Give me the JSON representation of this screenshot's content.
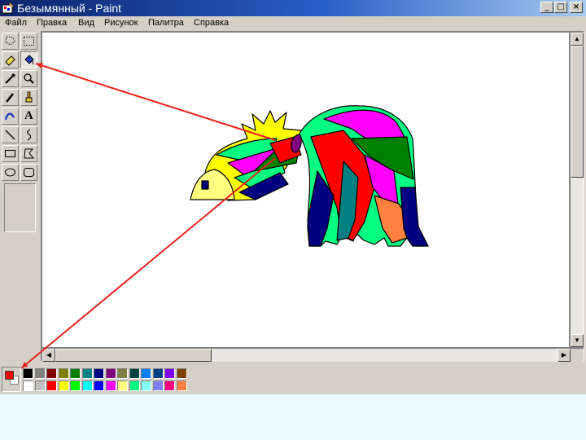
{
  "window": {
    "title": "Безымянный - Paint",
    "app_icon": "paint-app-icon",
    "controls": [
      {
        "name": "minimize-button",
        "glyph": "_"
      },
      {
        "name": "maximize-button",
        "glyph": "□"
      },
      {
        "name": "close-button",
        "glyph": "×"
      }
    ]
  },
  "menu": [
    {
      "label": "Файл"
    },
    {
      "label": "Правка"
    },
    {
      "label": "Вид"
    },
    {
      "label": "Рисунок"
    },
    {
      "label": "Палитра"
    },
    {
      "label": "Справка"
    }
  ],
  "tools": [
    {
      "name": "free-form-select-tool",
      "icon": "free-select-icon",
      "pressed": false
    },
    {
      "name": "rect-select-tool",
      "icon": "rect-select-icon",
      "pressed": false
    },
    {
      "name": "eraser-tool",
      "icon": "eraser-icon",
      "pressed": false
    },
    {
      "name": "fill-tool",
      "icon": "fill-bucket-icon",
      "pressed": true
    },
    {
      "name": "pick-color-tool",
      "icon": "eyedropper-icon",
      "pressed": false
    },
    {
      "name": "magnifier-tool",
      "icon": "magnifier-icon",
      "pressed": false
    },
    {
      "name": "pencil-tool",
      "icon": "pencil-icon",
      "pressed": false
    },
    {
      "name": "brush-tool",
      "icon": "brush-icon",
      "pressed": false
    },
    {
      "name": "airbrush-tool",
      "icon": "airbrush-icon",
      "pressed": false
    },
    {
      "name": "text-tool",
      "icon": "text-icon",
      "pressed": false,
      "glyph": "A"
    },
    {
      "name": "line-tool",
      "icon": "line-icon",
      "pressed": false
    },
    {
      "name": "curve-tool",
      "icon": "curve-icon",
      "pressed": false
    },
    {
      "name": "rectangle-tool",
      "icon": "rectangle-icon",
      "pressed": false
    },
    {
      "name": "polygon-tool",
      "icon": "polygon-icon",
      "pressed": false
    },
    {
      "name": "ellipse-tool",
      "icon": "ellipse-icon",
      "pressed": false
    },
    {
      "name": "rounded-rect-tool",
      "icon": "rounded-rect-icon",
      "pressed": false
    }
  ],
  "colors": {
    "foreground": "#ff0000",
    "background": "#ffffff",
    "palette_top": [
      "#000000",
      "#808080",
      "#800000",
      "#808000",
      "#008000",
      "#008080",
      "#000080",
      "#800080",
      "#808040",
      "#004040",
      "#0080ff",
      "#004080",
      "#8000ff",
      "#804000"
    ],
    "palette_bottom": [
      "#ffffff",
      "#c0c0c0",
      "#ff0000",
      "#ffff00",
      "#00ff00",
      "#00ffff",
      "#0000ff",
      "#ff00ff",
      "#ffff80",
      "#00ff80",
      "#80ffff",
      "#8080ff",
      "#ff0080",
      "#ff8040"
    ]
  },
  "annotation_color": "#e8221c"
}
